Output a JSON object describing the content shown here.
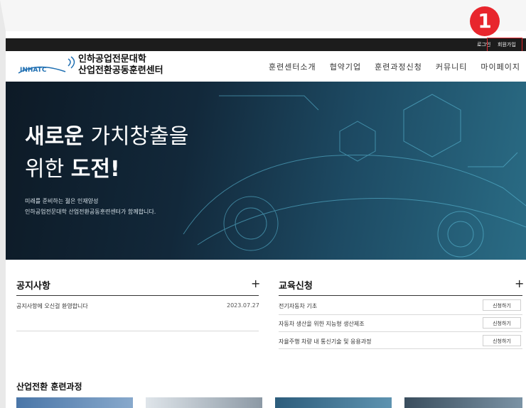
{
  "annotation": {
    "badge_number": "1"
  },
  "topbar": {
    "login": "로그인",
    "signup": "회원가입"
  },
  "header": {
    "logo_text": "INHATC",
    "title_line1": "인하공업전문대학",
    "title_line2": "산업전환공동훈련센터",
    "nav": [
      "훈련센터소개",
      "협약기업",
      "훈련과정신청",
      "커뮤니티",
      "마이페이지"
    ]
  },
  "hero": {
    "line1_bold": "새로운",
    "line1_rest": " 가치창출을",
    "line2_pre": "위한 ",
    "line2_bold": "도전!",
    "sub1": "미래를 준비하는 젊은 인재양성",
    "sub2": "인하공업전문대학 산업전환공동훈련센터가 함께합니다."
  },
  "notices": {
    "title": "공지사항",
    "plus": "+",
    "items": [
      {
        "text": "공지사항에 오신걸 환영합니다",
        "date": "2023.07.27"
      }
    ]
  },
  "applications": {
    "title": "교육신청",
    "plus": "+",
    "button_label": "신청하기",
    "courses": [
      "전기자동차 기초",
      "자동차 생산을 위한 지능형 생산제조",
      "자율주행 차량 내 통신기술 및 응용과정"
    ]
  },
  "training": {
    "title": "산업전환 훈련과정"
  },
  "colors": {
    "topbar": "#1c1c1c",
    "highlight": "#e0262d",
    "logo_blue": "#1f6fb2"
  }
}
